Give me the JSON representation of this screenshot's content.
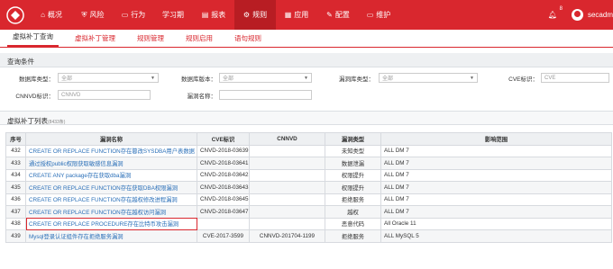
{
  "nav": {
    "items": [
      {
        "label": "概况",
        "icon": "home-icon"
      },
      {
        "label": "风险",
        "icon": "shield-icon"
      },
      {
        "label": "行为",
        "icon": "monitor-icon"
      },
      {
        "label": "学习期",
        "icon": ""
      },
      {
        "label": "报表",
        "icon": "report-icon"
      },
      {
        "label": "规则",
        "icon": "gear-icon"
      },
      {
        "label": "应用",
        "icon": "grid-icon"
      },
      {
        "label": "配置",
        "icon": "wrench-icon"
      },
      {
        "label": "维护",
        "icon": "monitor-icon"
      }
    ],
    "active_index": 5,
    "notification_count": "8",
    "user": "secadm"
  },
  "subnav": {
    "tabs": [
      "虚拟补丁查询",
      "虚拟补丁管理",
      "规则管理",
      "规则启用",
      "语句规则"
    ],
    "active_index": 0
  },
  "query": {
    "title": "查询条件",
    "db_type_label": "数据库类型：",
    "db_type_value": "全部",
    "db_version_label": "数据库版本：",
    "db_version_value": "全部",
    "vuln_type_label": "漏洞库类型：",
    "vuln_type_value": "全部",
    "cve_label": "CVE标识：",
    "cve_placeholder": "CVE",
    "cnnvd_label": "CNNVD标识：",
    "cnnvd_placeholder": "CNNVD",
    "vuln_name_label": "漏洞名称："
  },
  "list": {
    "title": "虚拟补丁列表",
    "count": "(8433条)",
    "columns": [
      "序号",
      "漏洞名称",
      "CVE标识",
      "CNNVD",
      "漏洞类型",
      "影响范围"
    ],
    "rows": [
      {
        "no": "432",
        "name": "CREATE OR REPLACE FUNCTION存在篡改SYSDBA用户表数据",
        "cve": "CNVD-2018-03639",
        "cnnvd": "",
        "type": "未知类型",
        "scope": "ALL DM 7"
      },
      {
        "no": "433",
        "name": "通过授权public权限获取敏感信息漏洞",
        "cve": "CNVD-2018-03641",
        "cnnvd": "",
        "type": "数据泄漏",
        "scope": "ALL DM 7"
      },
      {
        "no": "434",
        "name": "CREATE ANY package存在获取dba漏洞",
        "cve": "CNVD-2018-03642",
        "cnnvd": "",
        "type": "权限提升",
        "scope": "ALL DM 7"
      },
      {
        "no": "435",
        "name": "CREATE OR REPLACE FUNCTION存在获取DBA权限漏洞",
        "cve": "CNVD-2018-03643",
        "cnnvd": "",
        "type": "权限提升",
        "scope": "ALL DM 7"
      },
      {
        "no": "436",
        "name": "CREATE OR REPLACE FUNCTION存在越权修改进程漏洞",
        "cve": "CNVD-2018-03645",
        "cnnvd": "",
        "type": "拒绝服务",
        "scope": "ALL DM 7"
      },
      {
        "no": "437",
        "name": "CREATE OR REPLACE FUNCTION存在越权访问漏洞",
        "cve": "CNVD-2018-03647",
        "cnnvd": "",
        "type": "越权",
        "scope": "ALL DM 7"
      },
      {
        "no": "438",
        "name": "CREATE OR REPLACE PROCEDURE存在比特币攻击漏洞",
        "cve": "",
        "cnnvd": "",
        "type": "恶意代码",
        "scope": "All Oracle 11"
      },
      {
        "no": "439",
        "name": "Mysql登录认证组件存在拒绝服务漏洞",
        "cve": "CVE-2017-3599",
        "cnnvd": "CNNVD-201704-1199",
        "type": "拒绝服务",
        "scope": "ALL MySQL 5"
      }
    ],
    "highlighted_row_index": 6
  },
  "colors": {
    "brand": "#d9272e",
    "link": "#2a6fb8"
  }
}
